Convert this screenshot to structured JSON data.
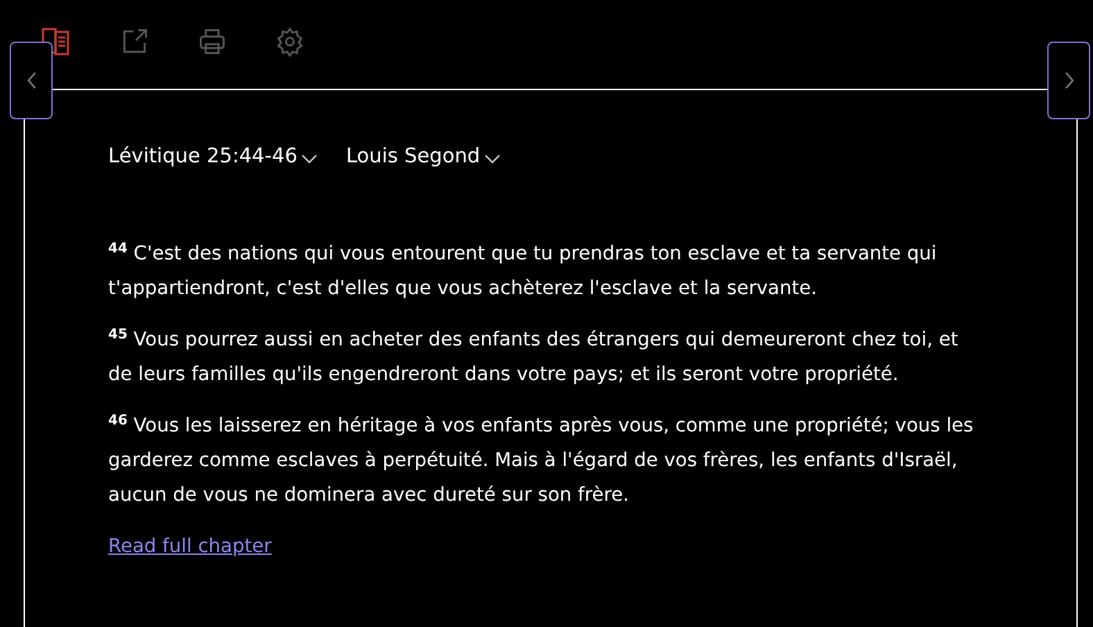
{
  "passage": {
    "reference": "Lévitique 25:44-46",
    "version": "Louis Segond"
  },
  "verses": [
    {
      "number": "44",
      "text": "C'est des nations qui vous entourent que tu prendras ton esclave et ta servante qui t'appartiendront, c'est d'elles que vous achèterez l'esclave et la servante."
    },
    {
      "number": "45",
      "text": "Vous pourrez aussi en acheter des enfants des étrangers qui demeureront chez toi, et de leurs familles qu'ils engendreront dans votre pays; et ils seront votre propriété."
    },
    {
      "number": "46",
      "text": "Vous les laisserez en héritage à vos enfants après vous, comme une propriété; vous les garderez comme esclaves à perpétuité. Mais à l'égard de vos frères, les enfants d'Israël, aucun de vous ne dominera avec dureté sur son frère."
    }
  ],
  "link": "Read full chapter"
}
